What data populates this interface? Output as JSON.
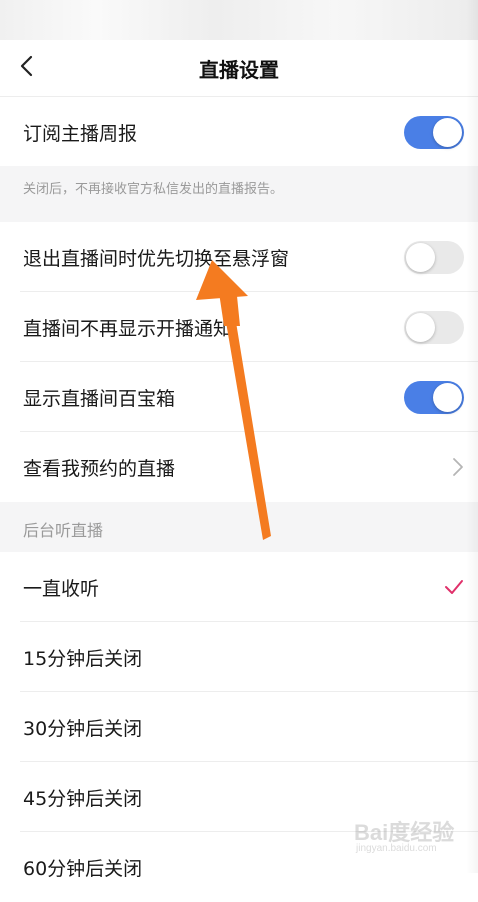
{
  "header": {
    "title": "直播设置"
  },
  "settings": {
    "subscribe_weekly": {
      "label": "订阅主播周报",
      "enabled": true
    },
    "note": "关闭后，不再接收官方私信发出的直播报告。",
    "float_window": {
      "label": "退出直播间时优先切换至悬浮窗",
      "enabled": false
    },
    "hide_notice": {
      "label": "直播间不再显示开播通知",
      "enabled": false
    },
    "show_treasure": {
      "label": "显示直播间百宝箱",
      "enabled": true
    },
    "my_reservations": {
      "label": "查看我预约的直播"
    }
  },
  "background_listen": {
    "header": "后台听直播",
    "options": [
      {
        "label": "一直收听",
        "selected": true
      },
      {
        "label": "15分钟后关闭",
        "selected": false
      },
      {
        "label": "30分钟后关闭",
        "selected": false
      },
      {
        "label": "45分钟后关闭",
        "selected": false
      },
      {
        "label": "60分钟后关闭",
        "selected": false
      }
    ]
  },
  "watermark": {
    "brand": "Bai度经验",
    "site": "jingyan.baidu.com"
  },
  "colors": {
    "toggle_on": "#4a7fe6",
    "toggle_off": "#e9e9e9",
    "check": "#e0306a",
    "arrow": "#f47b20",
    "section_bg": "#f5f5f6"
  },
  "icons": {
    "back": "chevron-left-icon",
    "chevron": "chevron-right-icon",
    "check": "checkmark-icon",
    "annotation": "orange-arrow"
  }
}
